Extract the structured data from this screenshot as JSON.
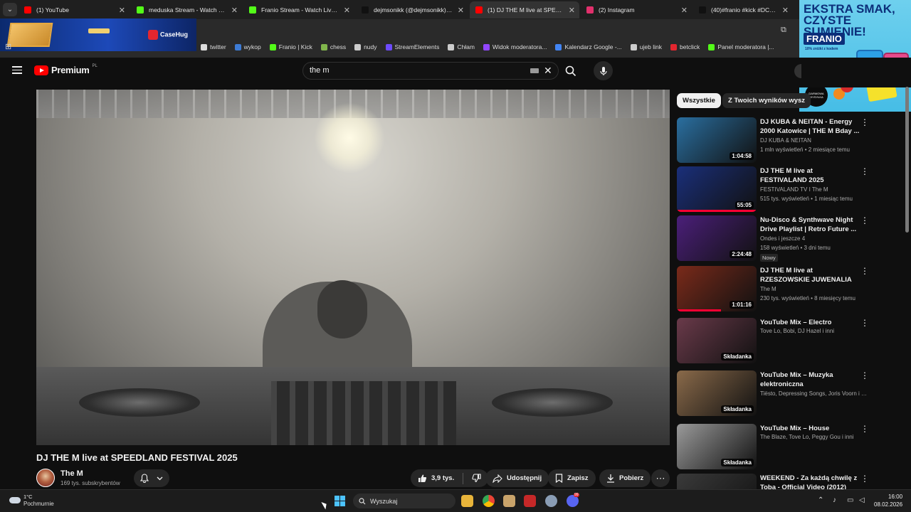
{
  "browser": {
    "tabs": [
      {
        "label": "(1) YouTube",
        "color": "#ff0000"
      },
      {
        "label": "meduska Stream - Watch Live o",
        "color": "#53fc18"
      },
      {
        "label": "Franio Stream - Watch Live on",
        "color": "#53fc18"
      },
      {
        "label": "dejmsonikk (@dejmsonikk) | Ti",
        "color": "#111111"
      },
      {
        "label": "(1) DJ THE M live at SPEEDLAN",
        "color": "#ff0000"
      },
      {
        "label": "(2) Instagram",
        "color": "#e1306c"
      },
      {
        "label": "(40)#franio #kick #DC @franio",
        "color": "#111111"
      }
    ],
    "bookmarks": [
      {
        "label": "twitter",
        "color": "#dddddd"
      },
      {
        "label": "wykop",
        "color": "#3d7bd4"
      },
      {
        "label": "Franio | Kick",
        "color": "#53fc18"
      },
      {
        "label": "chess",
        "color": "#81b64c"
      },
      {
        "label": "nudy",
        "color": "#cccccc"
      },
      {
        "label": "StreamElements",
        "color": "#6d4bff"
      },
      {
        "label": "Chłam",
        "color": "#cccccc"
      },
      {
        "label": "Widok moderatora...",
        "color": "#9146ff"
      },
      {
        "label": "Kalendarz Google -...",
        "color": "#4285f4"
      },
      {
        "label": "ujeb link",
        "color": "#cccccc"
      },
      {
        "label": "betclick",
        "color": "#e3262f"
      },
      {
        "label": "Panel moderatora |...",
        "color": "#53fc18"
      }
    ]
  },
  "ads": {
    "left_logo": "CaseHug",
    "right_headline": "EKSTRA SMAK, CZYSTE SUMIENIE!",
    "right_brand": "FRANIO",
    "right_sub": "10% zniżki z kodem",
    "right_badge": "DARMOWA WYSYŁKA"
  },
  "youtube": {
    "logo": "Premium",
    "region": "PL",
    "search_value": "the m",
    "video": {
      "title": "DJ THE M live at SPEEDLAND FESTIVAL 2025",
      "channel": "The M",
      "subscribers": "169 tys. subskrybentów",
      "likes": "3,9 tys.",
      "share": "Udostępnij",
      "save": "Zapisz",
      "download": "Pobierz"
    },
    "filters": [
      "Wszystkie",
      "Z Twoich wyników wysz"
    ],
    "recommendations": [
      {
        "title": "DJ KUBA & NEITAN - Energy 2000 Katowice | THE M Bday ...",
        "channel": "DJ KUBA & NEITAN",
        "meta": "1 mln wyświetleń • 2 miesiące temu",
        "duration": "1:04:58",
        "thumb": "#2a6fa0",
        "badge": "",
        "progress": 0
      },
      {
        "title": "DJ THE M live at FESTIVALAND 2025",
        "channel": "FESTIVALAND TV I The M",
        "meta": "515 tys. wyświetleń • 1 miesiąc temu",
        "duration": "55:05",
        "thumb": "#1a2f7a",
        "badge": "",
        "progress": 1.0
      },
      {
        "title": "Nu-Disco & Synthwave Night Drive Playlist | Retro Future ...",
        "channel": "Ondes i jeszcze 4",
        "meta": "158 wyświetleń • 3 dni temu",
        "duration": "2:24:48",
        "thumb": "#4b1f7a",
        "badge": "Nowy",
        "progress": 0
      },
      {
        "title": "DJ THE M live at RZESZOWSKIE JUWENALIA 2025",
        "channel": "The M",
        "meta": "230 tys. wyświetleń • 8 miesięcy temu",
        "duration": "1:01:16",
        "thumb": "#7a2a1a",
        "badge": "",
        "progress": 0.55
      },
      {
        "title": "YouTube Mix – Electro",
        "channel": "Tove Lo, Bobi, DJ Hazel i inni",
        "meta": "",
        "duration": "Składanka",
        "thumb": "#6a3a4a",
        "badge": "",
        "progress": 0
      },
      {
        "title": "YouTube Mix – Muzyka elektroniczna",
        "channel": "Tiësto, Depressing Songs, Joris Voorn i i...",
        "meta": "",
        "duration": "Składanka",
        "thumb": "#8a6a4a",
        "badge": "",
        "progress": 0
      },
      {
        "title": "YouTube Mix – House",
        "channel": "The Blaze, Tove Lo, Peggy Gou i inni",
        "meta": "",
        "duration": "Składanka",
        "thumb": "#9a9a9a",
        "badge": "",
        "progress": 0
      },
      {
        "title": "WEEKEND - Za każdą chwilę z Tobą - Official Video (2012)",
        "channel": "",
        "meta": "",
        "duration": "",
        "thumb": "#3a3a3a",
        "badge": "",
        "progress": 0
      }
    ]
  },
  "taskbar": {
    "temp": "1°C",
    "weather": "Pochmurnie",
    "search_placeholder": "Wyszukaj",
    "time": "16:00",
    "date": "08.02.2026",
    "discord_badge": "99"
  }
}
